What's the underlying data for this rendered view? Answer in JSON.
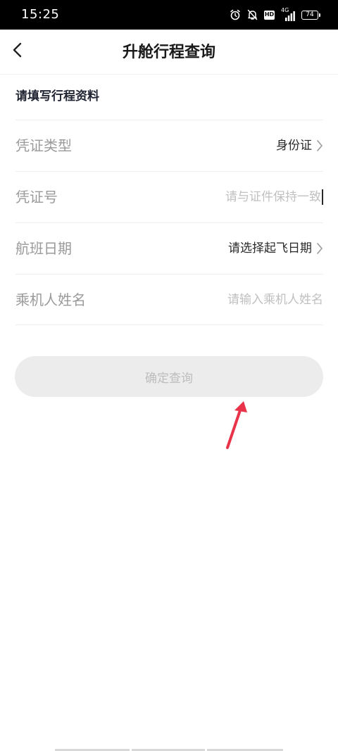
{
  "status_bar": {
    "time": "15:25",
    "network": "4G",
    "hd": "HD",
    "battery": "74"
  },
  "header": {
    "title": "升舱行程查询"
  },
  "form": {
    "section_title": "请填写行程资料",
    "id_type": {
      "label": "凭证类型",
      "value": "身份证"
    },
    "id_number": {
      "label": "凭证号",
      "placeholder": "请与证件保持一致"
    },
    "flight_date": {
      "label": "航班日期",
      "value": "请选择起飞日期"
    },
    "passenger_name": {
      "label": "乘机人姓名",
      "placeholder": "请输入乘机人姓名"
    }
  },
  "actions": {
    "submit_label": "确定查询"
  },
  "colors": {
    "annotation_arrow": "#e8334a",
    "button_disabled_bg": "#ececec",
    "button_disabled_text": "#bdbdbd"
  }
}
